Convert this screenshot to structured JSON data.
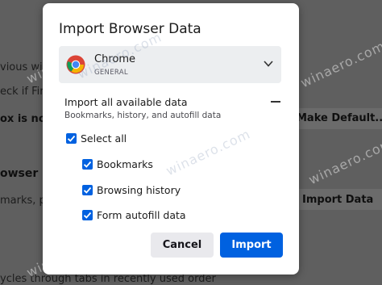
{
  "background": {
    "left_lines": [
      "vious wind",
      "eck if Fire",
      "ox is not y",
      "owser De",
      "marks, pa"
    ],
    "right_lines": {
      "make_default": "Make Default...",
      "import_data": "Import Data"
    },
    "bottom_line": "ycles through tabs in recently used order"
  },
  "dialog": {
    "title": "Import Browser Data",
    "browser": {
      "name": "Chrome",
      "profile": "GENERAL",
      "icon": "chrome-icon"
    },
    "section": {
      "title": "Import all available data",
      "subtitle": "Bookmarks, history, and autofill data"
    },
    "options": {
      "select_all": "Select all",
      "items": [
        "Bookmarks",
        "Browsing history",
        "Form autofill data"
      ]
    },
    "buttons": {
      "cancel": "Cancel",
      "import": "Import"
    }
  },
  "watermark": "winaero.com",
  "colors": {
    "accent": "#0061e0",
    "dialog_bg": "#ffffff",
    "backdrop": "#5f5f5f"
  }
}
